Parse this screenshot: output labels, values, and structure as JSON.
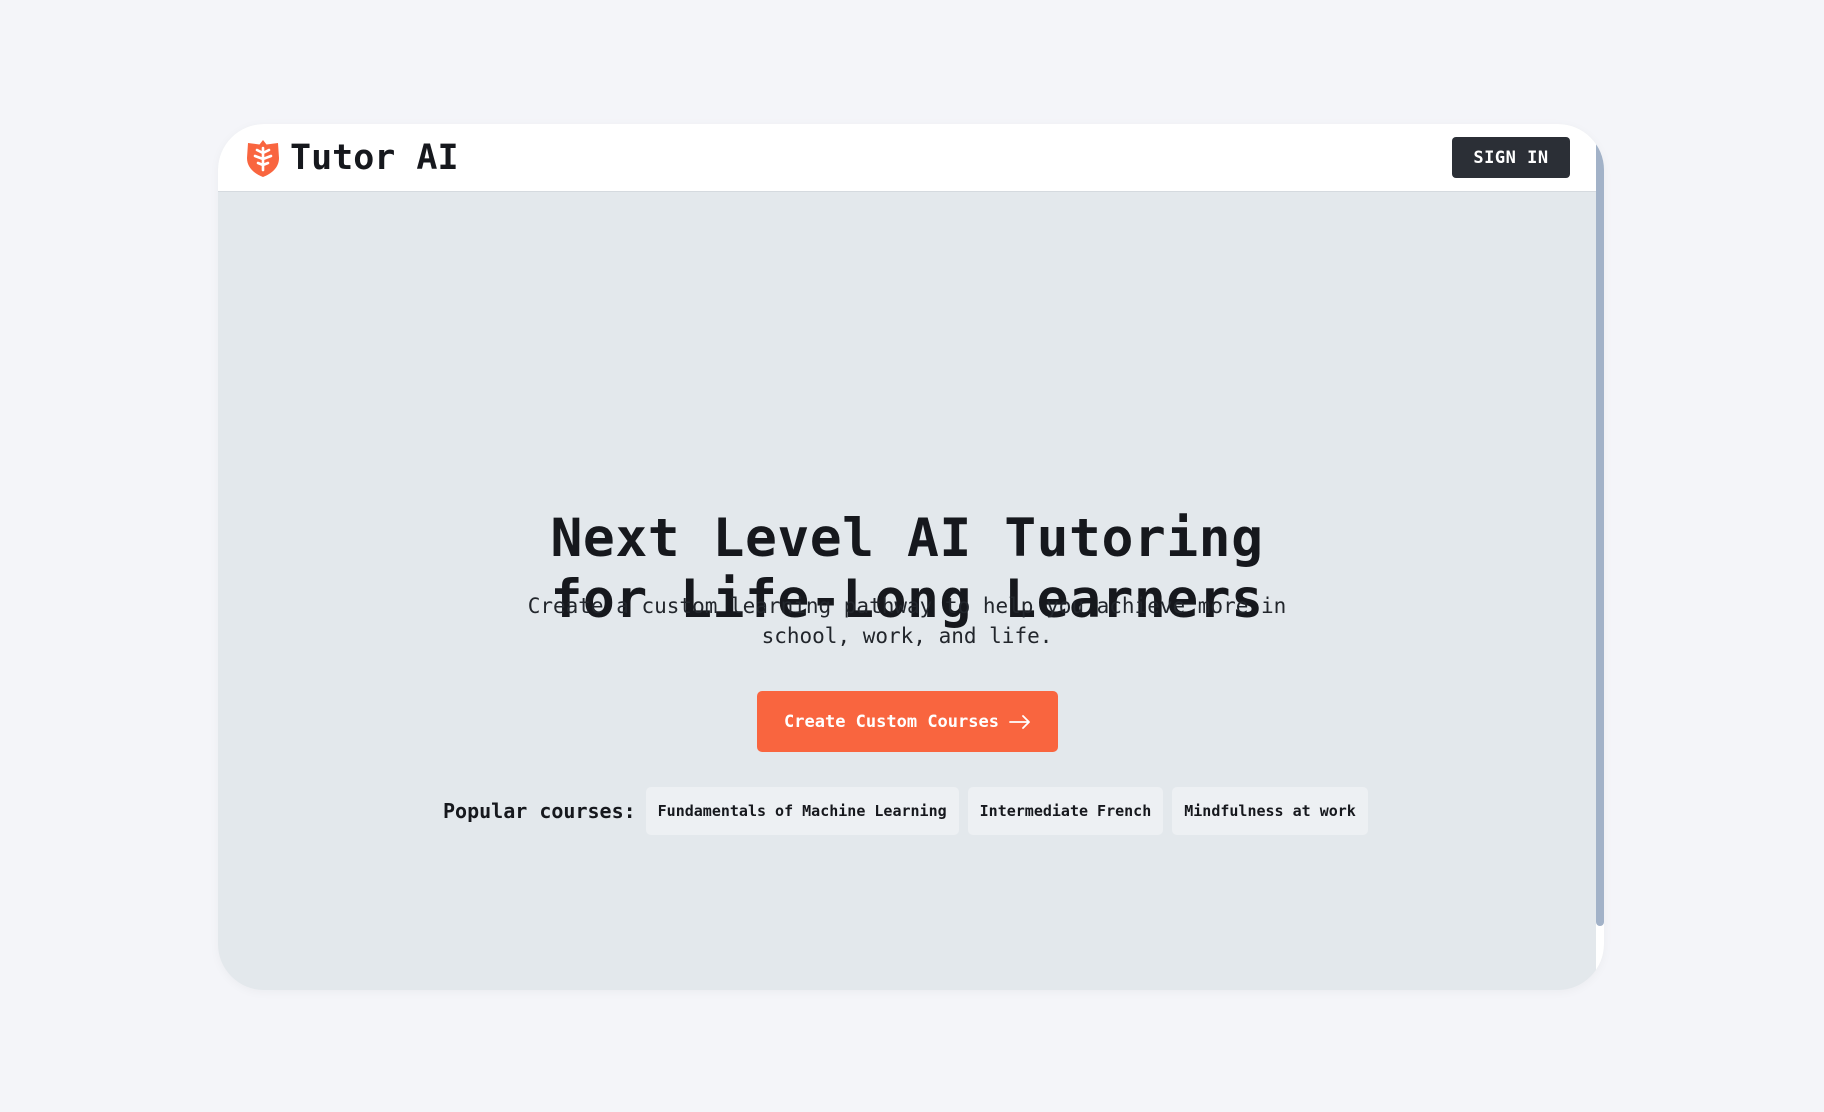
{
  "app": {
    "name": "Tutor AI",
    "logo_icon": "shield-brain-icon",
    "brand_color": "#f9653f"
  },
  "header": {
    "signin_label": "SIGN IN"
  },
  "hero": {
    "title_line1": "Next Level AI Tutoring",
    "title_line2": "for Life-Long Learners",
    "subtitle_line1": "Create a custom learning pathway to help you achieve more in",
    "subtitle_line2": "school, work, and life.",
    "cta_label": "Create Custom Courses",
    "cta_icon": "arrow-right-icon"
  },
  "popular": {
    "label": "Popular courses:",
    "courses": [
      "Fundamentals of Machine Learning",
      "Intermediate French",
      "Mindfulness at work"
    ]
  }
}
